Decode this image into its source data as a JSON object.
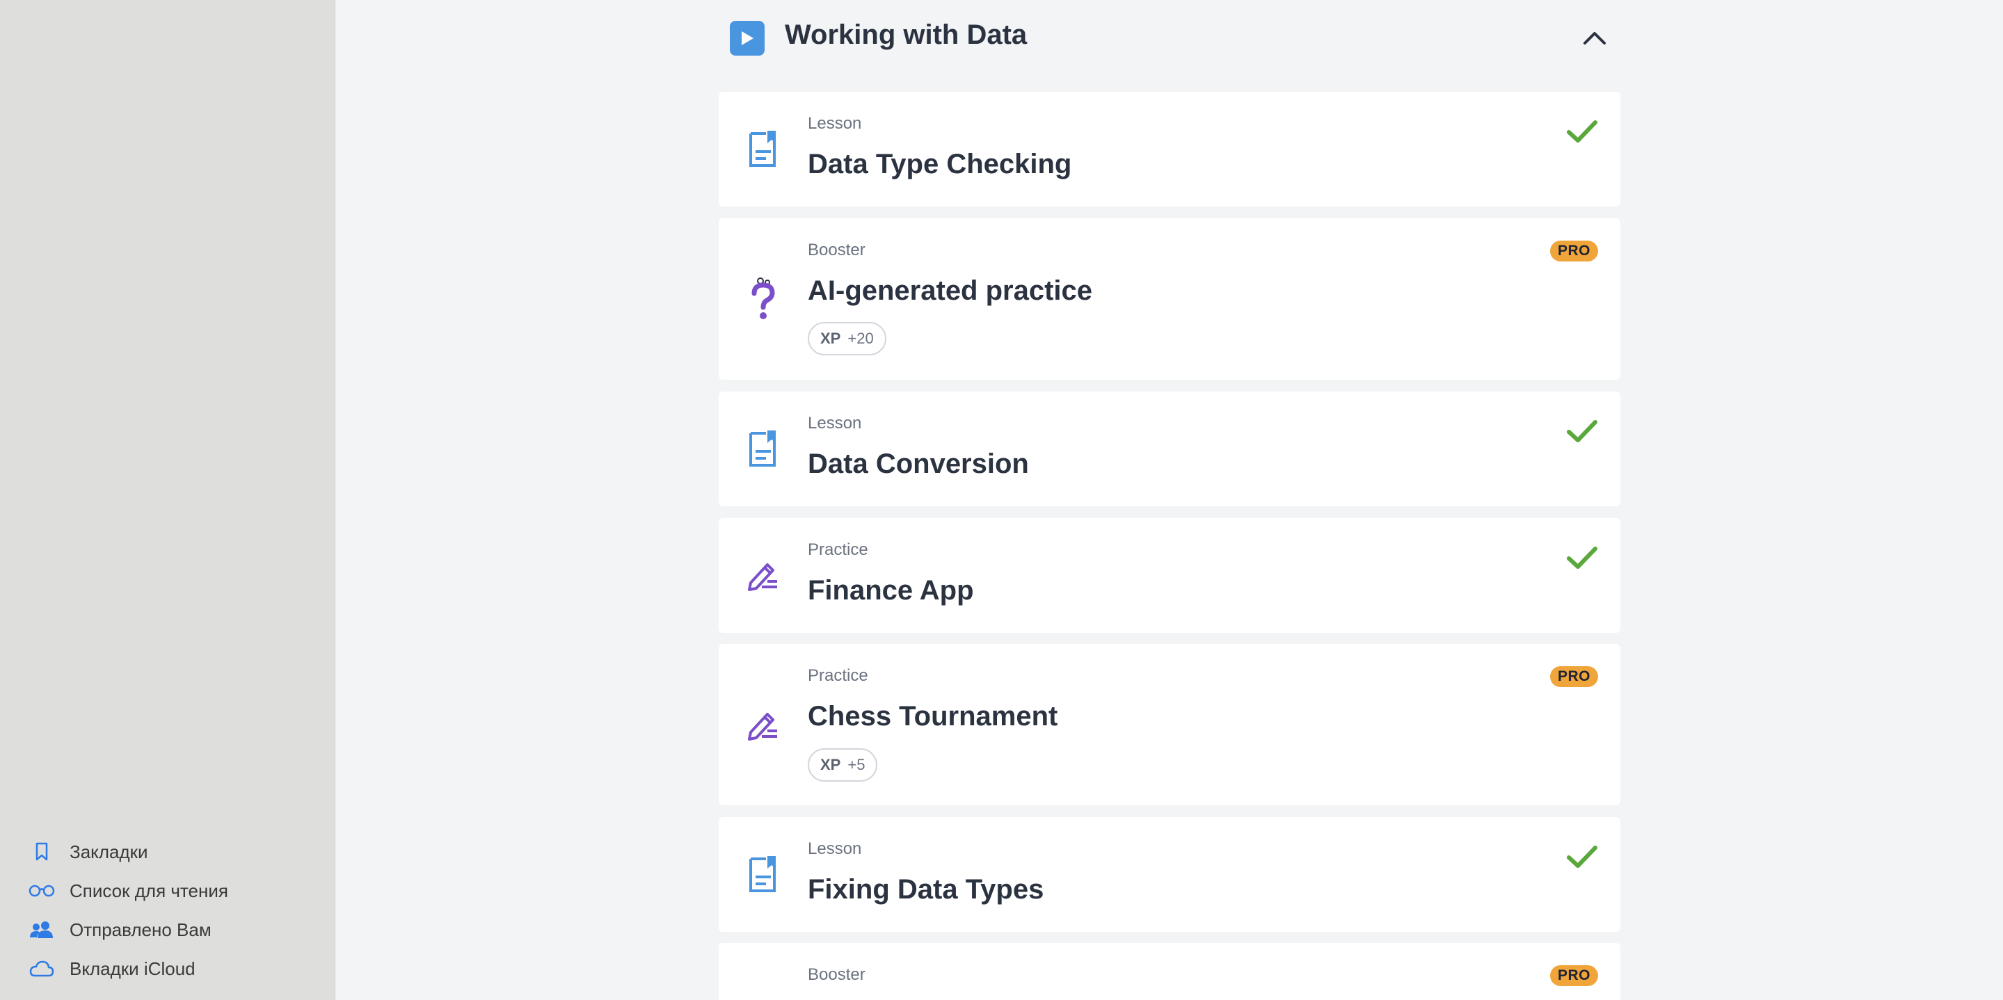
{
  "sidebar": {
    "items": [
      {
        "label": "Закладки",
        "icon": "bookmark-icon"
      },
      {
        "label": "Список для чтения",
        "icon": "reading-list-icon"
      },
      {
        "label": "Отправлено Вам",
        "icon": "shared-with-you-icon"
      },
      {
        "label": "Вкладки iCloud",
        "icon": "icloud-icon"
      }
    ]
  },
  "section": {
    "title": "Working with Data",
    "icon": "play-icon",
    "collapse_icon": "chevron-up-icon"
  },
  "cards": [
    {
      "type": "Lesson",
      "title": "Data Type Checking",
      "icon": "lesson-doc-icon",
      "status": "completed"
    },
    {
      "type": "Booster",
      "title": "AI-generated practice",
      "icon": "question-mark-icon",
      "badge": "PRO",
      "xp_label": "XP",
      "xp_value": "+20"
    },
    {
      "type": "Lesson",
      "title": "Data Conversion",
      "icon": "lesson-doc-icon",
      "status": "completed"
    },
    {
      "type": "Practice",
      "title": "Finance App",
      "icon": "pencil-icon",
      "status": "completed"
    },
    {
      "type": "Practice",
      "title": "Chess Tournament",
      "icon": "pencil-icon",
      "badge": "PRO",
      "xp_label": "XP",
      "xp_value": "+5"
    },
    {
      "type": "Lesson",
      "title": "Fixing Data Types",
      "icon": "lesson-doc-icon",
      "status": "completed"
    },
    {
      "type": "Booster",
      "badge": "PRO"
    }
  ],
  "colors": {
    "accent_blue": "#4a95e0",
    "check_green": "#5aa83b",
    "pro_orange": "#f0a53a",
    "practice_purple": "#7b4fc9"
  }
}
